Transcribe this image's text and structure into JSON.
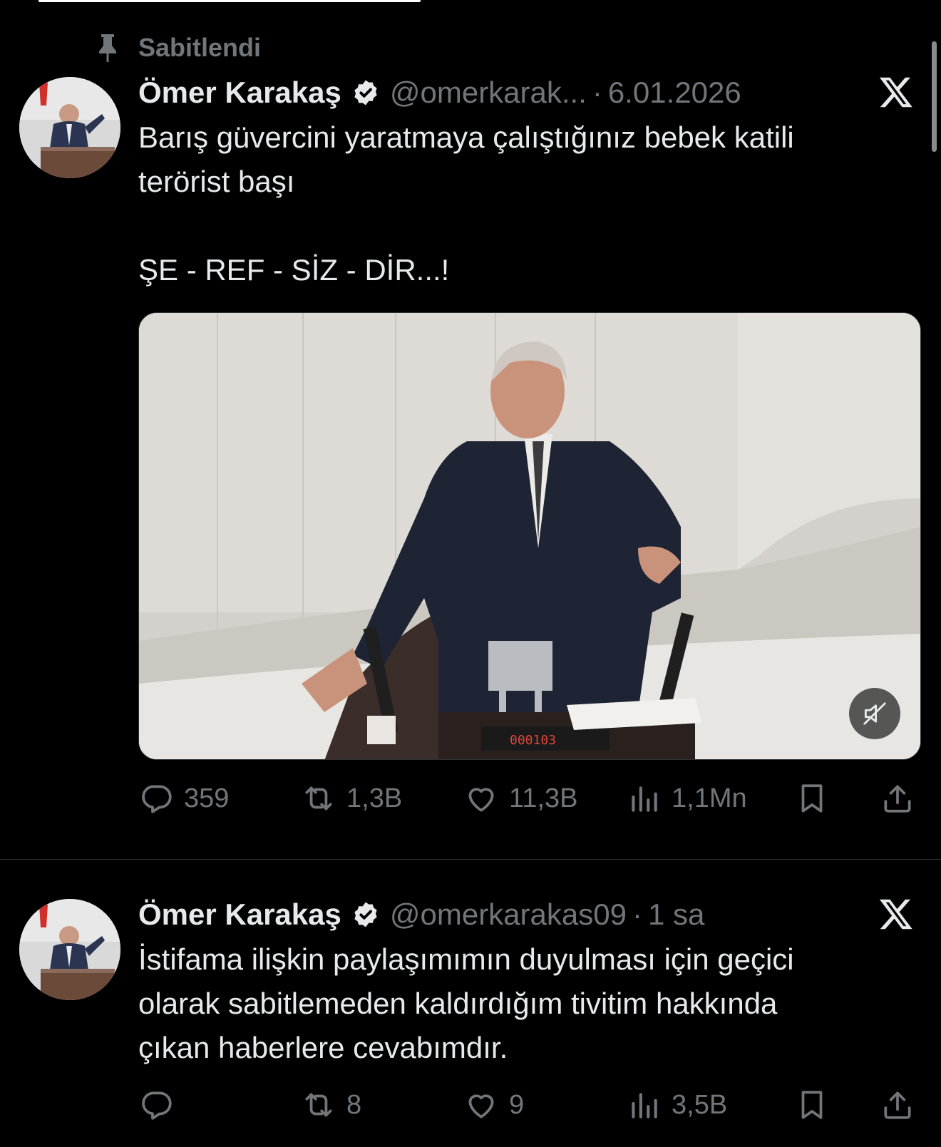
{
  "pinned": {
    "label": "Sabitlendi",
    "icon": "pin-icon"
  },
  "tweets": [
    {
      "author": {
        "name": "Ömer Karakaş",
        "handle": "@omerkarak...",
        "verified": true,
        "avatar": "avatar-icon"
      },
      "dot": "·",
      "time": "6.01.2026",
      "text": "Barış güvercini yaratmaya çalıştığınız bebek katili\nterörist başı\n\nŞE - REF - SİZ - DİR...!",
      "media": {
        "type": "video",
        "timer": "000103",
        "mute_icon": "mute-icon"
      },
      "stats": {
        "replies": "359",
        "reposts": "1,3B",
        "likes": "11,3B",
        "views": "1,1Mn"
      }
    },
    {
      "author": {
        "name": "Ömer Karakaş",
        "handle": "@omerkarakas09",
        "verified": true,
        "avatar": "avatar-icon"
      },
      "dot": "·",
      "time": "1 sa",
      "text": "İstifama ilişkin paylaşımımın duyulması için geçici\nolarak sabitlemeden kaldırdığım tivitim hakkında\nçıkan haberlere cevabımdır.",
      "stats": {
        "replies": "",
        "reposts": "8",
        "likes": "9",
        "views": "3,5B"
      }
    }
  ],
  "colors": {
    "background": "#000000",
    "text": "#e7e9ea",
    "muted": "#71767b",
    "verified": "#e7e9ea",
    "divider": "#2f3336"
  }
}
